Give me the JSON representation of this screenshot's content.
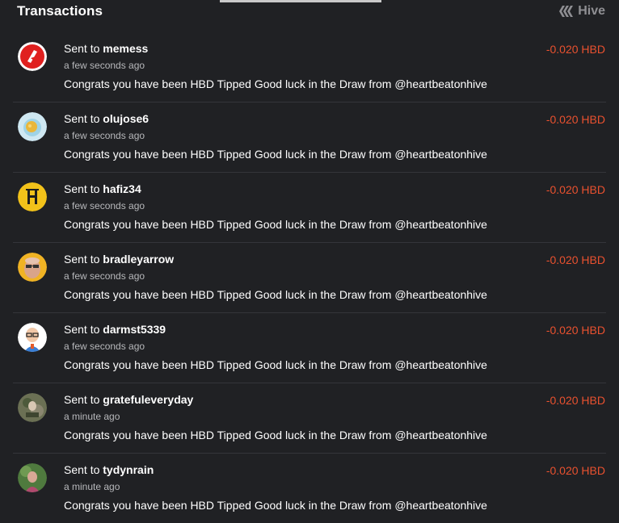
{
  "header": {
    "title": "Transactions",
    "brand": "Hive"
  },
  "colors": {
    "background": "#202124",
    "amount_negative": "#e9512f",
    "divider": "#34353a",
    "muted_text": "#b7b8bb"
  },
  "transactions": [
    {
      "prefix": "Sent to",
      "user": "memess",
      "time": "a few seconds ago",
      "memo": "Congrats you have been HBD Tipped Good luck in the Draw from @heartbeatonhive",
      "amount": "-0.020 HBD",
      "avatar": "memess-avatar"
    },
    {
      "prefix": "Sent to",
      "user": "olujose6",
      "time": "a few seconds ago",
      "memo": "Congrats you have been HBD Tipped Good luck in the Draw from @heartbeatonhive",
      "amount": "-0.020 HBD",
      "avatar": "olujose6-avatar"
    },
    {
      "prefix": "Sent to",
      "user": "hafiz34",
      "time": "a few seconds ago",
      "memo": "Congrats you have been HBD Tipped Good luck in the Draw from @heartbeatonhive",
      "amount": "-0.020 HBD",
      "avatar": "hafiz34-avatar"
    },
    {
      "prefix": "Sent to",
      "user": "bradleyarrow",
      "time": "a few seconds ago",
      "memo": "Congrats you have been HBD Tipped Good luck in the Draw from @heartbeatonhive",
      "amount": "-0.020 HBD",
      "avatar": "bradleyarrow-avatar"
    },
    {
      "prefix": "Sent to",
      "user": "darmst5339",
      "time": "a few seconds ago",
      "memo": "Congrats you have been HBD Tipped Good luck in the Draw from @heartbeatonhive",
      "amount": "-0.020 HBD",
      "avatar": "darmst5339-avatar"
    },
    {
      "prefix": "Sent to",
      "user": "gratefuleveryday",
      "time": "a minute ago",
      "memo": "Congrats you have been HBD Tipped Good luck in the Draw from @heartbeatonhive",
      "amount": "-0.020 HBD",
      "avatar": "gratefuleveryday-avatar"
    },
    {
      "prefix": "Sent to",
      "user": "tydynrain",
      "time": "a minute ago",
      "memo": "Congrats you have been HBD Tipped Good luck in the Draw from @heartbeatonhive",
      "amount": "-0.020 HBD",
      "avatar": "tydynrain-avatar"
    }
  ]
}
